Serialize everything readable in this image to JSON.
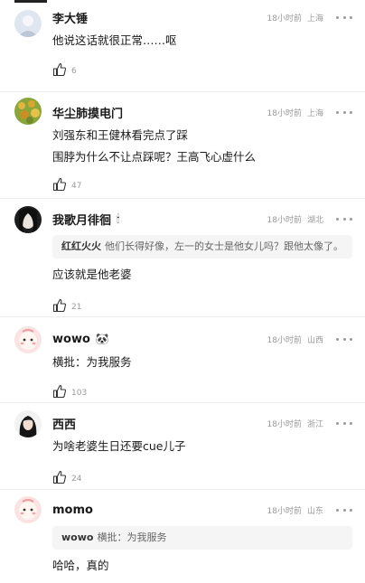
{
  "comments": [
    {
      "name": "李大锤",
      "time": "18小时前",
      "location": "上海",
      "lines": [
        "他说这话就很正常……呕"
      ],
      "likes": "6"
    },
    {
      "name": "华尘肺摸电门",
      "time": "18小时前",
      "location": "上海",
      "lines": [
        "刘强东和王健林看完点了踩",
        "围脖为什么不让点踩呢？王高飞心虚什么"
      ],
      "likes": "47"
    },
    {
      "name": "我歌月徘徊",
      "badge": "🕯",
      "time": "18小时前",
      "location": "湖北",
      "quote_name": "红红火火",
      "quote_text": "他们长得好像，左一的女士是他女儿吗？跟他太像了。",
      "lines": [
        "应该就是他老婆"
      ],
      "likes": "21"
    },
    {
      "name": "wowo",
      "badge": "🐼",
      "time": "18小时前",
      "location": "山西",
      "lines": [
        "横批：为我服务"
      ],
      "likes": "103"
    },
    {
      "name": "西西",
      "time": "18小时前",
      "location": "浙江",
      "lines": [
        "为啥老婆生日还要cue儿子"
      ],
      "likes": "24"
    },
    {
      "name": "momo",
      "time": "18小时前",
      "location": "山东",
      "quote_name": "wowo",
      "quote_text": "横批：为我服务",
      "lines": [
        "哈哈，真的"
      ]
    }
  ]
}
